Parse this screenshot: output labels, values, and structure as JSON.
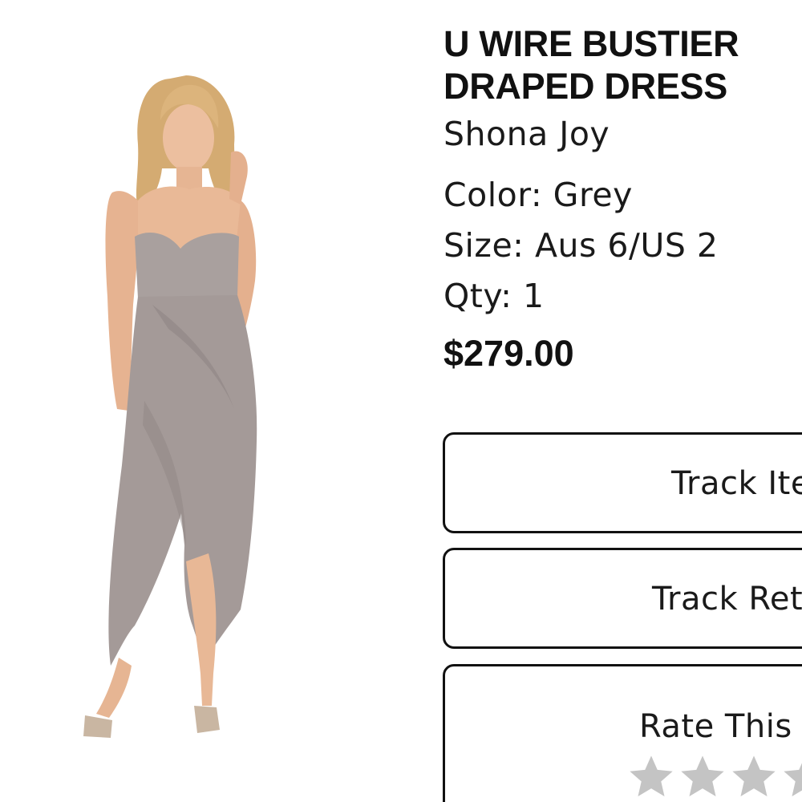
{
  "product": {
    "title_line1": "U WIRE BUSTIER",
    "title_line2": "DRAPED DRESS",
    "brand": "Shona Joy",
    "color_text": "Color: Grey",
    "size_text": "Size: Aus 6/US 2",
    "qty_text": "Qty: 1",
    "price": "$279.00",
    "image_icon": "product-photo-dress"
  },
  "actions": {
    "track_item_label": "Track Ite",
    "track_return_label": "Track Ret",
    "rate_label": "Rate This"
  },
  "rating": {
    "stars_visible": 4,
    "star_color": "#c4c4c4"
  },
  "colors": {
    "dress": "#a49a98",
    "skin": "#e8b896",
    "hair": "#d9b27a",
    "button_border": "#111111"
  }
}
